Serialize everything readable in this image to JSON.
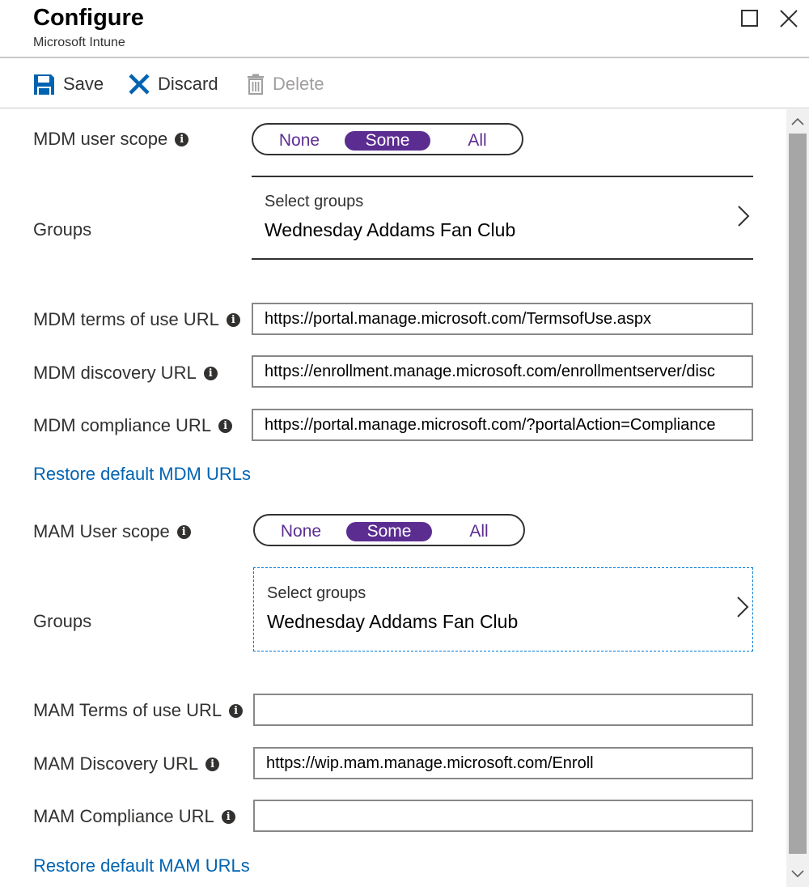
{
  "header": {
    "title": "Configure",
    "subtitle": "Microsoft Intune"
  },
  "toolbar": {
    "save_label": "Save",
    "discard_label": "Discard",
    "delete_label": "Delete"
  },
  "mdm": {
    "scope_label": "MDM user scope",
    "scope_options": [
      "None",
      "Some",
      "All"
    ],
    "scope_selected": "Some",
    "groups_label": "Groups",
    "groups_sub": "Select groups",
    "groups_value": "Wednesday Addams Fan Club",
    "terms_label": "MDM terms of use URL",
    "terms_value": "https://portal.manage.microsoft.com/TermsofUse.aspx",
    "discovery_label": "MDM discovery URL",
    "discovery_value": "https://enrollment.manage.microsoft.com/enrollmentserver/disc",
    "compliance_label": "MDM compliance URL",
    "compliance_value": "https://portal.manage.microsoft.com/?portalAction=Compliance",
    "restore_label": "Restore default MDM URLs"
  },
  "mam": {
    "scope_label": "MAM User scope",
    "scope_options": [
      "None",
      "Some",
      "All"
    ],
    "scope_selected": "Some",
    "groups_label": "Groups",
    "groups_sub": "Select groups",
    "groups_value": "Wednesday Addams Fan Club",
    "terms_label": "MAM Terms of use URL",
    "terms_value": "",
    "discovery_label": "MAM Discovery URL",
    "discovery_value": "https://wip.mam.manage.microsoft.com/Enroll",
    "compliance_label": "MAM Compliance URL",
    "compliance_value": "",
    "restore_label": "Restore default MAM URLs"
  },
  "colors": {
    "accent": "#5c2d91",
    "link": "#0063b1",
    "save_icon": "#0063b1",
    "discard_icon": "#0063b1"
  },
  "icons": {
    "save": "save-icon",
    "discard": "close-x-icon",
    "delete": "trash-icon",
    "info": "info-icon",
    "chevron": "chevron-right-icon"
  }
}
